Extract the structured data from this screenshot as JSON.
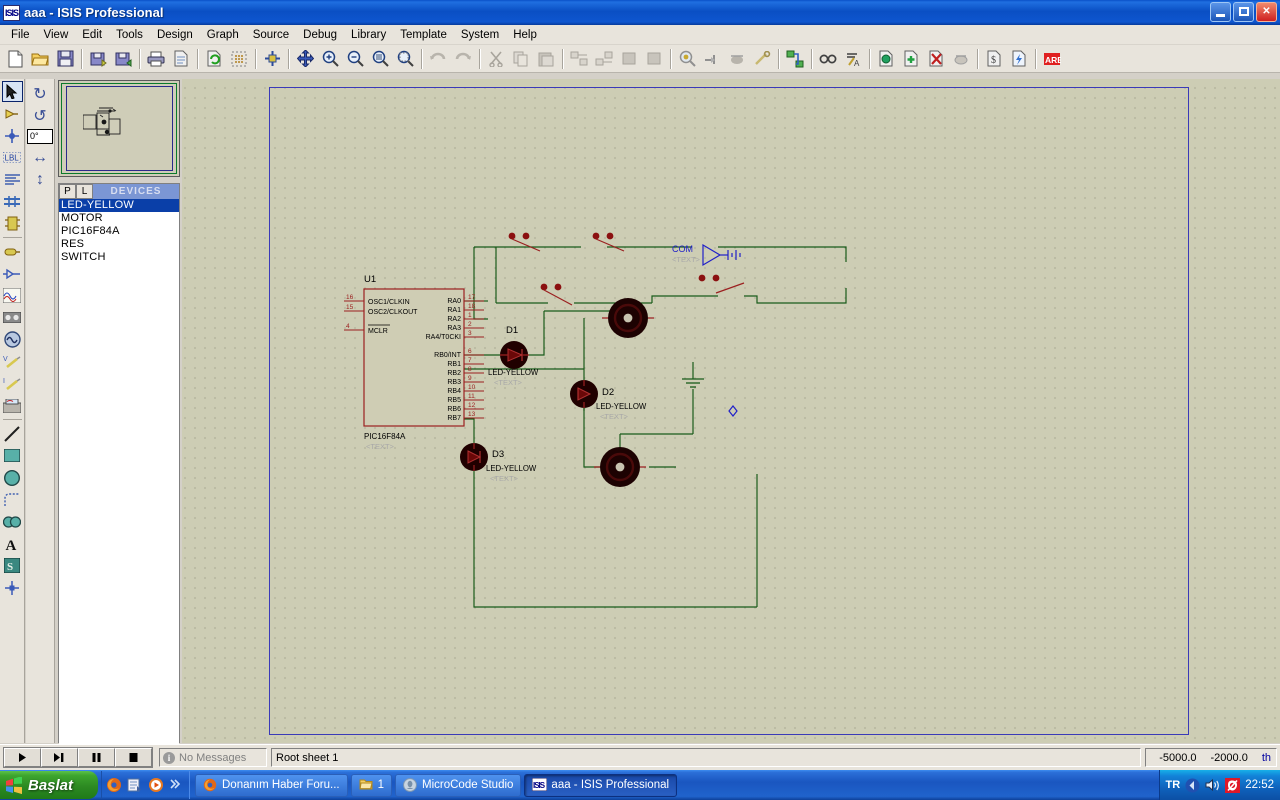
{
  "window": {
    "title": "aaa - ISIS Professional",
    "app_icon": "isis-icon",
    "minimize_label": "Minimize",
    "maximize_label": "Maximize",
    "close_label": "Close"
  },
  "menubar": {
    "items": [
      {
        "label": "File"
      },
      {
        "label": "View"
      },
      {
        "label": "Edit"
      },
      {
        "label": "Tools"
      },
      {
        "label": "Design"
      },
      {
        "label": "Graph"
      },
      {
        "label": "Source"
      },
      {
        "label": "Debug"
      },
      {
        "label": "Library"
      },
      {
        "label": "Template"
      },
      {
        "label": "System"
      },
      {
        "label": "Help"
      }
    ]
  },
  "toolbar": {
    "groups": [
      [
        "new-file-icon",
        "open-folder-icon",
        "save-icon"
      ],
      [
        "import-section-icon",
        "export-section-icon"
      ],
      [
        "print-icon",
        "print-area-icon"
      ],
      [
        "refresh-display-icon",
        "toggle-grid-icon"
      ],
      [
        "origin-icon"
      ],
      [
        "pan-icon",
        "zoom-in-icon",
        "zoom-out-icon",
        "zoom-all-icon",
        "zoom-area-icon"
      ],
      [
        "undo-icon",
        "redo-icon"
      ],
      [
        "cut-icon",
        "copy-icon",
        "paste-icon"
      ],
      [
        "block-copy-icon",
        "block-move-icon",
        "block-rotate-icon",
        "block-delete-icon"
      ],
      [
        "pick-device-icon",
        "make-device-icon",
        "packaging-tool-icon",
        "decompose-icon"
      ],
      [
        "wire-autorouter-icon"
      ],
      [
        "search-tag-icon",
        "property-assignment-icon"
      ],
      [
        "design-explorer-icon",
        "new-sheet-icon",
        "remove-sheet-icon",
        "exit-sheet-icon"
      ],
      [
        "bill-of-materials-icon",
        "electrical-rule-check-icon"
      ],
      [
        "netlist-to-ares-icon"
      ]
    ]
  },
  "left_toolbar": {
    "items": [
      {
        "name": "selection-mode",
        "icon": "arrow-cursor-icon",
        "selected": true
      },
      {
        "name": "component-mode",
        "icon": "component-icon",
        "selected": false
      },
      {
        "name": "junction-dot-mode",
        "icon": "junction-dot-icon",
        "selected": false
      },
      {
        "name": "wire-label-mode",
        "icon": "label-icon",
        "selected": false
      },
      {
        "name": "text-script-mode",
        "icon": "text-script-icon",
        "selected": false
      },
      {
        "name": "bus-mode",
        "icon": "bus-icon",
        "selected": false
      },
      {
        "name": "subcircuit-mode",
        "icon": "subcircuit-icon",
        "selected": false
      },
      {
        "name": "terminals-mode",
        "icon": "terminal-icon",
        "selected": false
      },
      {
        "name": "device-pin-mode",
        "icon": "device-pin-icon",
        "selected": false
      },
      {
        "name": "graph-mode",
        "icon": "graph-icon",
        "selected": false
      },
      {
        "name": "tape-recorder-mode",
        "icon": "tape-recorder-icon",
        "selected": false
      },
      {
        "name": "generator-mode",
        "icon": "generator-icon",
        "selected": false
      },
      {
        "name": "voltage-probe-mode",
        "icon": "voltage-probe-icon",
        "selected": false
      },
      {
        "name": "current-probe-mode",
        "icon": "current-probe-icon",
        "selected": false
      },
      {
        "name": "virtual-instrument-mode",
        "icon": "instrument-icon",
        "selected": false
      },
      {
        "name": "line-tool",
        "icon": "line-icon",
        "selected": false
      },
      {
        "name": "box-tool",
        "icon": "rectangle-icon",
        "selected": false
      },
      {
        "name": "circle-tool",
        "icon": "circle-icon",
        "selected": false
      },
      {
        "name": "arc-tool",
        "icon": "arc-icon",
        "selected": false
      },
      {
        "name": "path-tool",
        "icon": "path-icon",
        "selected": false
      },
      {
        "name": "text-tool",
        "icon": "text-a-icon",
        "selected": false
      },
      {
        "name": "symbol-tool",
        "icon": "symbol-s-icon",
        "selected": false
      },
      {
        "name": "marker-tool",
        "icon": "marker-icon",
        "selected": false
      }
    ]
  },
  "rotation_panel": {
    "rotate_cw_label": "↻",
    "rotate_ccw_label": "↺",
    "angle_value": "0°",
    "mirror_x_label": "↔",
    "mirror_y_label": "↕"
  },
  "devices_panel": {
    "tab_p": "P",
    "tab_l": "L",
    "title": "DEVICES",
    "items": [
      {
        "label": "LED-YELLOW",
        "selected": true
      },
      {
        "label": "MOTOR",
        "selected": false
      },
      {
        "label": "PIC16F84A",
        "selected": false
      },
      {
        "label": "RES",
        "selected": false
      },
      {
        "label": "SWITCH",
        "selected": false
      }
    ]
  },
  "statusbar": {
    "animation_controls": [
      {
        "name": "play-button",
        "glyph": "▶"
      },
      {
        "name": "step-button",
        "glyph": "▶|"
      },
      {
        "name": "pause-button",
        "glyph": "❚❚"
      },
      {
        "name": "stop-button",
        "glyph": "■"
      }
    ],
    "messages": "No Messages",
    "sheet": "Root sheet 1",
    "coord_x": "-5000.0",
    "coord_y": "-2000.0",
    "coord_unit": "th"
  },
  "taskbar": {
    "start_label": "Başlat",
    "quicklaunch": [
      "firefox-icon",
      "show-desktop-icon",
      "media-player-icon",
      "chevron-more-icon"
    ],
    "tasks": [
      {
        "label": "Donanım Haber Foru...",
        "icon": "firefox-icon",
        "active": false
      },
      {
        "label": "1",
        "icon": "folder-icon",
        "active": false
      },
      {
        "label": "MicroCode Studio",
        "icon": "microcode-icon",
        "active": false
      },
      {
        "label": "aaa - ISIS Professional",
        "icon": "isis-icon",
        "active": true
      }
    ],
    "tray": {
      "language": "TR",
      "icons": [
        "network-icon",
        "volume-icon",
        "avira-icon"
      ],
      "time": "22:52"
    }
  },
  "schematic": {
    "sheet_name": "Root sheet 1",
    "colors": {
      "wire": "#1a5c1a",
      "body": "#cfcdb4",
      "outline": "#9b2020",
      "pin": "#9b2020",
      "text": "#000000",
      "grey_text": "#a8a8a8",
      "blue_text": "#2020c8",
      "led_body": "#200000"
    },
    "components": [
      {
        "ref": "U1",
        "value": "PIC16F84A",
        "text": "<TEXT>",
        "left_pins": [
          {
            "name": "OSC1/CLKIN",
            "num": "16"
          },
          {
            "name": "OSC2/CLKOUT",
            "num": "15"
          },
          {
            "name": "MCLR",
            "num": "4"
          }
        ],
        "right_pins": [
          {
            "name": "RA0",
            "num": "17"
          },
          {
            "name": "RA1",
            "num": "18"
          },
          {
            "name": "RA2",
            "num": "1"
          },
          {
            "name": "RA3",
            "num": "2"
          },
          {
            "name": "RA4/T0CKI",
            "num": "3"
          },
          {
            "name": "RB0/INT",
            "num": "6"
          },
          {
            "name": "RB1",
            "num": "7"
          },
          {
            "name": "RB2",
            "num": "8"
          },
          {
            "name": "RB3",
            "num": "9"
          },
          {
            "name": "RB4",
            "num": "10"
          },
          {
            "name": "RB5",
            "num": "11"
          },
          {
            "name": "RB6",
            "num": "12"
          },
          {
            "name": "RB7",
            "num": "13"
          }
        ]
      },
      {
        "ref": "D1",
        "value": "LED-YELLOW",
        "text": "<TEXT>"
      },
      {
        "ref": "D2",
        "value": "LED-YELLOW",
        "text": "<TEXT>"
      },
      {
        "ref": "D3",
        "value": "LED-YELLOW",
        "text": "<TEXT>"
      },
      {
        "ref": "COM",
        "value": "",
        "text": "<TEXT>"
      }
    ]
  }
}
